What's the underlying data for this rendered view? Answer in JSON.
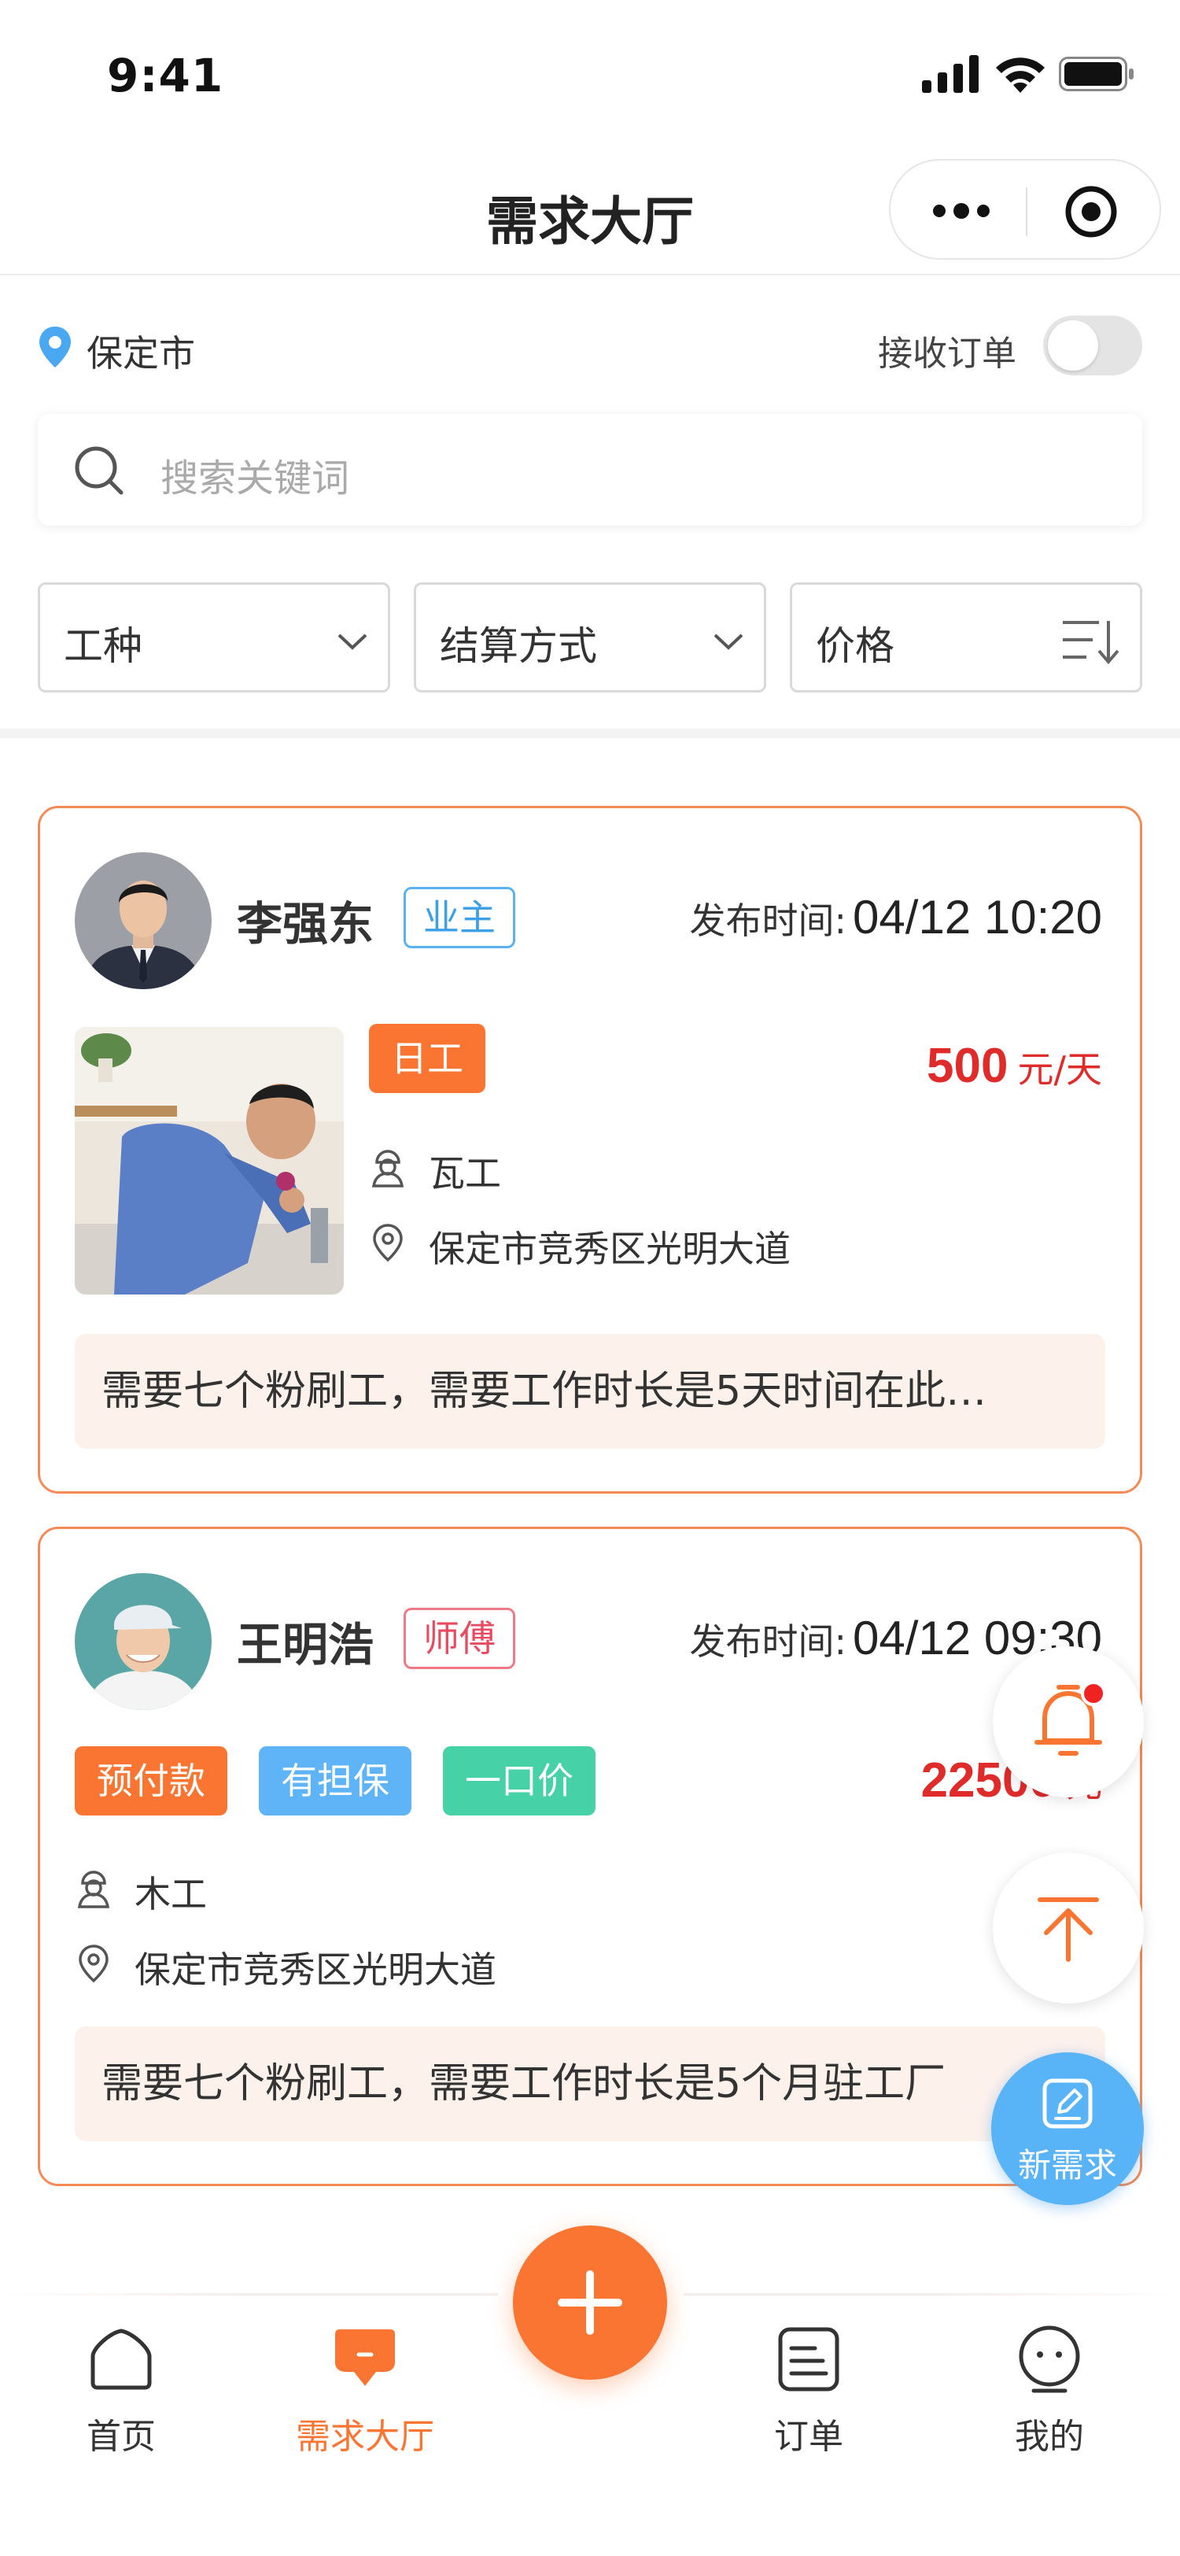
{
  "status_bar": {
    "time": "9:41"
  },
  "nav": {
    "title": "需求大厅"
  },
  "location": {
    "city": "保定市",
    "receive_label": "接收订单",
    "receive_on": false
  },
  "search": {
    "placeholder": "搜索关键词"
  },
  "filters": [
    {
      "label": "工种",
      "icon": "chevron-down-icon"
    },
    {
      "label": "结算方式",
      "icon": "chevron-down-icon"
    },
    {
      "label": "价格",
      "icon": "sort-icon"
    }
  ],
  "cards": [
    {
      "name": "李强东",
      "role": "业主",
      "time_label": "发布时间:",
      "time": "04/12 10:20",
      "tags": [
        "日工"
      ],
      "price": "500",
      "unit": "元/天",
      "trade": "瓦工",
      "address": "保定市竞秀区光明大道",
      "desc": "需要七个粉刷工，需要工作时长是5天时间在此…"
    },
    {
      "name": "王明浩",
      "role": "师傅",
      "time_label": "发布时间:",
      "time": "04/12 09:30",
      "tags": [
        "预付款",
        "有担保",
        "一口价"
      ],
      "price": "22500",
      "unit": "元",
      "trade": "木工",
      "address": "保定市竞秀区光明大道",
      "desc": "需要七个粉刷工，需要工作时长是5个月驻工厂"
    }
  ],
  "fabs": {
    "new_label": "新需求"
  },
  "tabbar": [
    {
      "label": "首页",
      "icon": "home-icon",
      "active": false
    },
    {
      "label": "需求大厅",
      "icon": "hall-icon",
      "active": true
    },
    {
      "label": "订单",
      "icon": "order-icon",
      "active": false
    },
    {
      "label": "我的",
      "icon": "profile-icon",
      "active": false
    }
  ],
  "colors": {
    "accent": "#fb7532",
    "price": "#e02b2b",
    "blue": "#58b3f7",
    "teal": "#47d1a6"
  }
}
